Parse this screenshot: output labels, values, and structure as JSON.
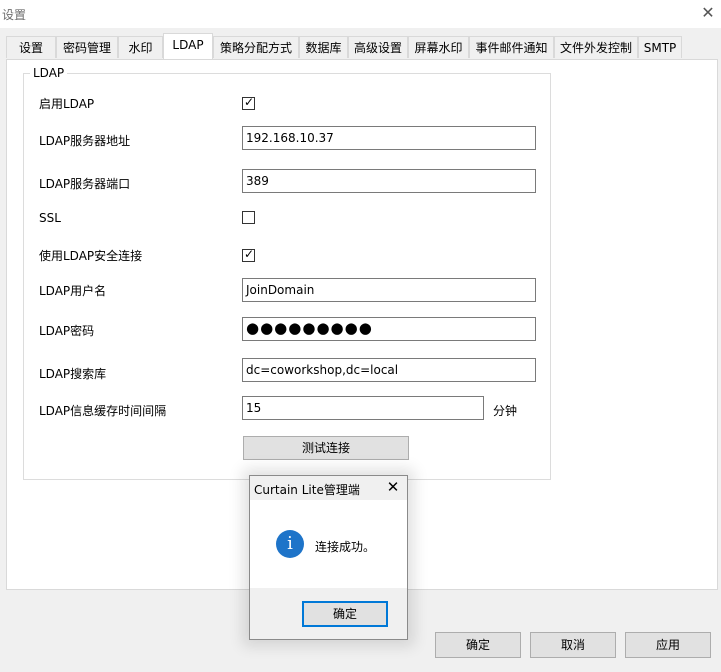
{
  "window": {
    "title": "设置",
    "close_glyph": "✕"
  },
  "tabs": [
    {
      "label": "设置"
    },
    {
      "label": "密码管理"
    },
    {
      "label": "水印"
    },
    {
      "label": "LDAP"
    },
    {
      "label": "策略分配方式"
    },
    {
      "label": "数据库"
    },
    {
      "label": "高级设置"
    },
    {
      "label": "屏幕水印"
    },
    {
      "label": "事件邮件通知"
    },
    {
      "label": "文件外发控制"
    },
    {
      "label": "SMTP"
    }
  ],
  "active_tab": "LDAP",
  "ldap": {
    "group_title": "LDAP",
    "enable_label": "启用LDAP",
    "enable_checked": true,
    "server_label": "LDAP服务器地址",
    "server_value": "192.168.10.37",
    "port_label": "LDAP服务器端口",
    "port_value": "389",
    "ssl_label": "SSL",
    "ssl_checked": false,
    "secure_label": "使用LDAP安全连接",
    "secure_checked": true,
    "user_label": "LDAP用户名",
    "user_value": "JoinDomain",
    "password_label": "LDAP密码",
    "password_mask": "●●●●●●●●●",
    "searchbase_label": "LDAP搜索库",
    "searchbase_value": "dc=coworkshop,dc=local",
    "cache_label": "LDAP信息缓存时间间隔",
    "cache_value": "15",
    "cache_unit": "分钟",
    "test_button": "测试连接",
    "check_glyph": "✓"
  },
  "footer": {
    "ok": "确定",
    "cancel": "取消",
    "apply": "应用"
  },
  "dialog": {
    "title": "Curtain Lite管理端",
    "close_glyph": "✕",
    "icon": "info-icon",
    "icon_glyph": "i",
    "message": "连接成功。",
    "ok": "确定",
    "accent": "#0078d7"
  }
}
